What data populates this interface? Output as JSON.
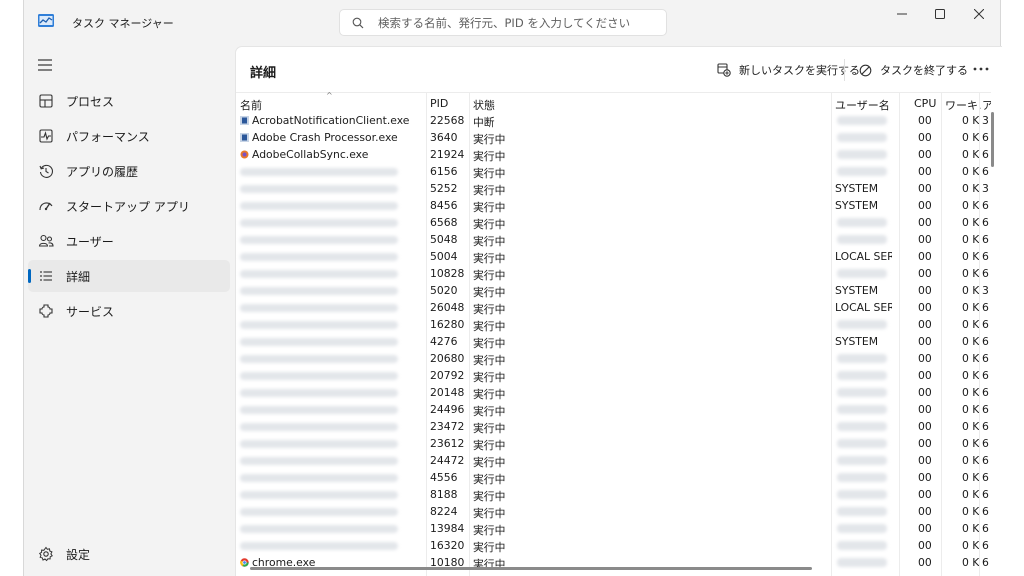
{
  "app": {
    "title": "タスク マネージャー"
  },
  "search": {
    "placeholder": "検索する名前、発行元、PID を入力してください"
  },
  "sidebar": {
    "items": [
      {
        "label": "プロセス",
        "icon": "processes-icon"
      },
      {
        "label": "パフォーマンス",
        "icon": "performance-icon"
      },
      {
        "label": "アプリの履歴",
        "icon": "app-history-icon"
      },
      {
        "label": "スタートアップ アプリ",
        "icon": "startup-icon"
      },
      {
        "label": "ユーザー",
        "icon": "users-icon"
      },
      {
        "label": "詳細",
        "icon": "details-icon",
        "active": true
      },
      {
        "label": "サービス",
        "icon": "services-icon"
      }
    ],
    "settings_label": "設定"
  },
  "page": {
    "title": "詳細",
    "run_task_label": "新しいタスクを実行する",
    "end_task_label": "タスクを終了する"
  },
  "table": {
    "headers": {
      "name": "名前",
      "pid": "PID",
      "status": "状態",
      "user": "ユーザー名",
      "cpu": "CPU",
      "mem": "ワーキ...",
      "arch": "ア"
    },
    "rows": [
      {
        "name": "AcrobatNotificationClient.exe",
        "pid": "22568",
        "status": "中断",
        "user": "",
        "cpu": "00",
        "mem": "0 K",
        "arch": "3"
      },
      {
        "name": "Adobe Crash Processor.exe",
        "pid": "3640",
        "status": "実行中",
        "user": "",
        "cpu": "00",
        "mem": "0 K",
        "arch": "6"
      },
      {
        "name": "AdobeCollabSync.exe",
        "pid": "21924",
        "status": "実行中",
        "user": "",
        "cpu": "00",
        "mem": "0 K",
        "arch": "6"
      },
      {
        "name": "",
        "pid": "6156",
        "status": "実行中",
        "user": "",
        "cpu": "00",
        "mem": "0 K",
        "arch": "6"
      },
      {
        "name": "",
        "pid": "5252",
        "status": "実行中",
        "user": "SYSTEM",
        "cpu": "00",
        "mem": "0 K",
        "arch": "3"
      },
      {
        "name": "",
        "pid": "8456",
        "status": "実行中",
        "user": "SYSTEM",
        "cpu": "00",
        "mem": "0 K",
        "arch": "6"
      },
      {
        "name": "",
        "pid": "6568",
        "status": "実行中",
        "user": "",
        "cpu": "00",
        "mem": "0 K",
        "arch": "6"
      },
      {
        "name": "",
        "pid": "5048",
        "status": "実行中",
        "user": "",
        "cpu": "00",
        "mem": "0 K",
        "arch": "6"
      },
      {
        "name": "",
        "pid": "5004",
        "status": "実行中",
        "user": "LOCAL SER...",
        "cpu": "00",
        "mem": "0 K",
        "arch": "6"
      },
      {
        "name": "",
        "pid": "10828",
        "status": "実行中",
        "user": "",
        "cpu": "00",
        "mem": "0 K",
        "arch": "6"
      },
      {
        "name": "",
        "pid": "5020",
        "status": "実行中",
        "user": "SYSTEM",
        "cpu": "00",
        "mem": "0 K",
        "arch": "3"
      },
      {
        "name": "",
        "pid": "26048",
        "status": "実行中",
        "user": "LOCAL SER...",
        "cpu": "00",
        "mem": "0 K",
        "arch": "6"
      },
      {
        "name": "",
        "pid": "16280",
        "status": "実行中",
        "user": "",
        "cpu": "00",
        "mem": "0 K",
        "arch": "6"
      },
      {
        "name": "",
        "pid": "4276",
        "status": "実行中",
        "user": "SYSTEM",
        "cpu": "00",
        "mem": "0 K",
        "arch": "6"
      },
      {
        "name": "",
        "pid": "20680",
        "status": "実行中",
        "user": "",
        "cpu": "00",
        "mem": "0 K",
        "arch": "6"
      },
      {
        "name": "",
        "pid": "20792",
        "status": "実行中",
        "user": "",
        "cpu": "00",
        "mem": "0 K",
        "arch": "6"
      },
      {
        "name": "",
        "pid": "20148",
        "status": "実行中",
        "user": "",
        "cpu": "00",
        "mem": "0 K",
        "arch": "6"
      },
      {
        "name": "",
        "pid": "24496",
        "status": "実行中",
        "user": "",
        "cpu": "00",
        "mem": "0 K",
        "arch": "6"
      },
      {
        "name": "",
        "pid": "23472",
        "status": "実行中",
        "user": "",
        "cpu": "00",
        "mem": "0 K",
        "arch": "6"
      },
      {
        "name": "",
        "pid": "23612",
        "status": "実行中",
        "user": "",
        "cpu": "00",
        "mem": "0 K",
        "arch": "6"
      },
      {
        "name": "",
        "pid": "24472",
        "status": "実行中",
        "user": "",
        "cpu": "00",
        "mem": "0 K",
        "arch": "6"
      },
      {
        "name": "",
        "pid": "4556",
        "status": "実行中",
        "user": "",
        "cpu": "00",
        "mem": "0 K",
        "arch": "6"
      },
      {
        "name": "",
        "pid": "8188",
        "status": "実行中",
        "user": "",
        "cpu": "00",
        "mem": "0 K",
        "arch": "6"
      },
      {
        "name": "",
        "pid": "8224",
        "status": "実行中",
        "user": "",
        "cpu": "00",
        "mem": "0 K",
        "arch": "6"
      },
      {
        "name": "",
        "pid": "13984",
        "status": "実行中",
        "user": "",
        "cpu": "00",
        "mem": "0 K",
        "arch": "6"
      },
      {
        "name": "",
        "pid": "16320",
        "status": "実行中",
        "user": "",
        "cpu": "00",
        "mem": "0 K",
        "arch": "6"
      },
      {
        "name": "chrome.exe",
        "pid": "10180",
        "status": "実行中",
        "user": "",
        "cpu": "00",
        "mem": "0 K",
        "arch": "6"
      }
    ]
  },
  "colors": {
    "accent": "#0067c0",
    "window_bg": "#f3f3f3",
    "panel_bg": "#ffffff"
  }
}
